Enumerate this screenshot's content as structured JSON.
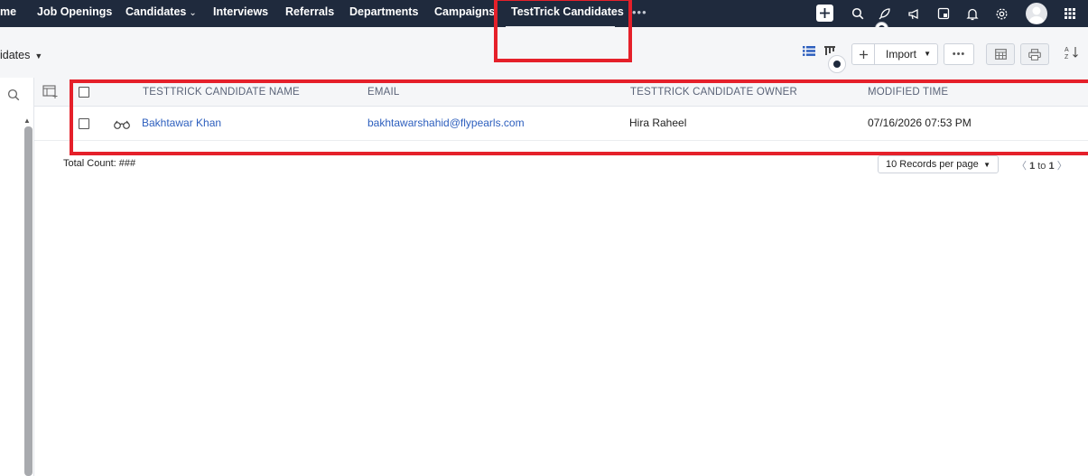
{
  "nav": {
    "items": [
      "me",
      "Job Openings",
      "Candidates",
      "Interviews",
      "Referrals",
      "Departments",
      "Campaigns",
      "TestTrick Candidates"
    ],
    "more": "•••"
  },
  "view": {
    "title": "idates"
  },
  "toolbar": {
    "import_label": "Import",
    "more": "•••"
  },
  "table": {
    "headers": [
      "TESTTRICK CANDIDATE NAME",
      "EMAIL",
      "TESTTRICK CANDIDATE OWNER",
      "MODIFIED TIME"
    ],
    "rows": [
      {
        "name": "Bakhtawar Khan",
        "email": "bakhtawarshahid@flypearls.com",
        "owner": "Hira Raheel",
        "modified": "07/16/2026 07:53 PM"
      }
    ]
  },
  "footer": {
    "total_count": "Total Count: ###",
    "records_per_page": "10 Records per page",
    "page_from": "1",
    "page_to_word": "to",
    "page_to": "1"
  },
  "colors": {
    "nav_bg": "#1f2a3d",
    "link": "#2d5fbe",
    "highlight": "#e5202a",
    "subheader_bg": "#f5f6f8"
  },
  "icons": [
    "search-icon",
    "rocket-icon",
    "megaphone-icon",
    "calendar-icon",
    "bell-icon",
    "gear-icon",
    "apps-grid-icon",
    "list-view-icon",
    "kanban-view-icon",
    "sort-az-icon",
    "printer-icon",
    "table-settings-icon",
    "binoculars-icon"
  ]
}
